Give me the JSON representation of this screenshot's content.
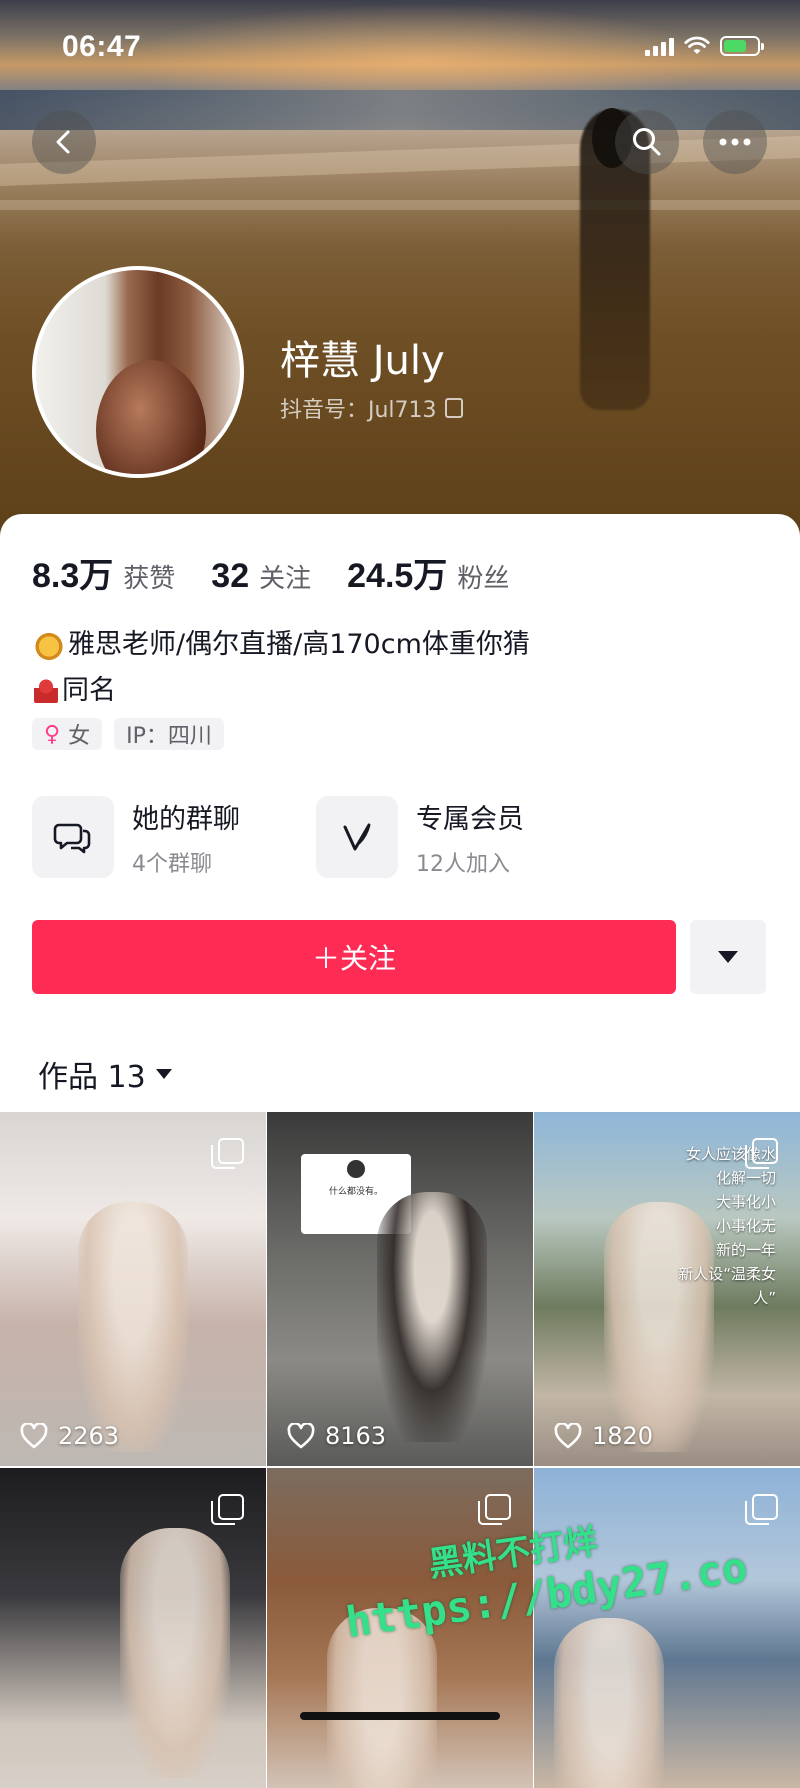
{
  "status_bar": {
    "time": "06:47"
  },
  "profile": {
    "name": "梓慧 July",
    "handle": "抖音号：Jul713",
    "stats": [
      {
        "value": "8.3万",
        "label": "获赞"
      },
      {
        "value": "32",
        "label": "关注"
      },
      {
        "value": "24.5万",
        "label": "粉丝"
      }
    ],
    "bio_line1": "雅思老师/偶尔直播/高170cm体重你猜",
    "bio_line2": "同名",
    "tags": {
      "gender": "女",
      "ip": "IP：四川"
    }
  },
  "features": {
    "group_chat": {
      "title": "她的群聊",
      "sub": "4个群聊",
      "icon": "chat-bubbles-icon"
    },
    "membership": {
      "title": "专属会员",
      "sub": "12人加入",
      "icon": "v-logo-icon"
    }
  },
  "actions": {
    "follow_label": "＋关注"
  },
  "works": {
    "label": "作品 13"
  },
  "grid": [
    {
      "likes": "2263"
    },
    {
      "likes": "8163",
      "card_text": "什么都没有。"
    },
    {
      "likes": "1820",
      "overlay": "女人应该像水\n化解一切\n大事化小\n小事化无\n新的一年\n新人设“温柔女人”"
    },
    {},
    {},
    {}
  ],
  "watermark": {
    "line1": "黑料不打烊",
    "line2": "https://bdy27.co"
  },
  "colors": {
    "accent": "#fe2c55",
    "watermark": "#34e08a"
  }
}
